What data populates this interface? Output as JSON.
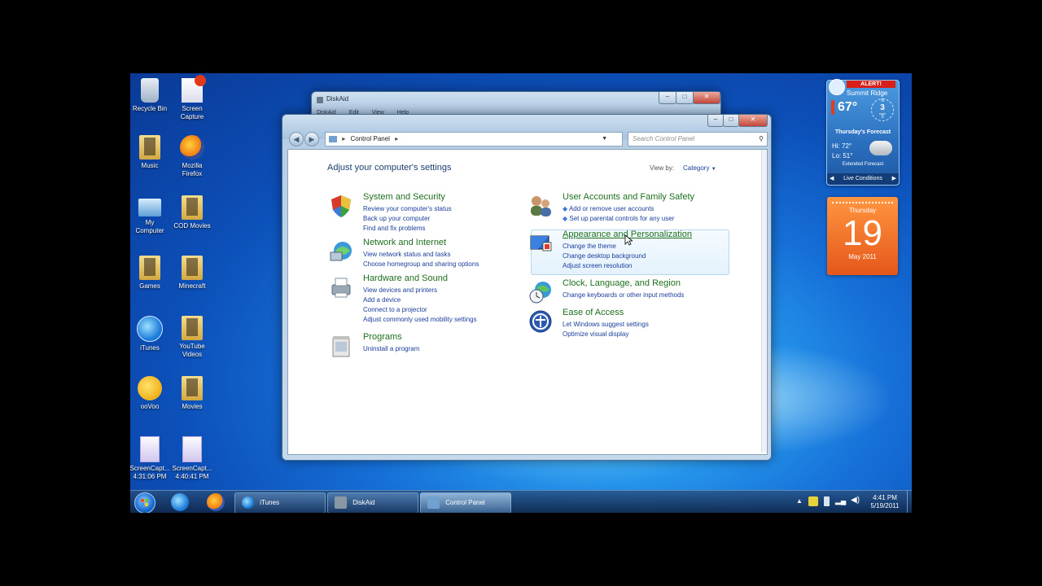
{
  "desktop": {
    "icons": [
      {
        "label": "Recycle Bin"
      },
      {
        "label": "Screen Capture"
      },
      {
        "label": "Music"
      },
      {
        "label": "Mozilla Firefox"
      },
      {
        "label": "My Computer"
      },
      {
        "label": "COD Movies"
      },
      {
        "label": "Games"
      },
      {
        "label": "Minecraft"
      },
      {
        "label": "iTunes"
      },
      {
        "label": "YouTube Videos"
      },
      {
        "label": "ooVoo"
      },
      {
        "label": "Movies"
      },
      {
        "label": "ScreenCapt... 4:31:06 PM"
      },
      {
        "label": "ScreenCapt... 4:40:41 PM"
      }
    ]
  },
  "diskaid_window": {
    "title": "DiskAid",
    "menu": [
      "DiskAid",
      "Edit",
      "View",
      "Help"
    ]
  },
  "control_panel": {
    "address": "Control Panel",
    "search_placeholder": "Search Control Panel",
    "heading": "Adjust your computer's settings",
    "view_by_label": "View by:",
    "view_by_value": "Category",
    "categories": [
      {
        "title": "System and Security",
        "links": [
          "Review your computer's status",
          "Back up your computer",
          "Find and fix problems"
        ]
      },
      {
        "title": "Network and Internet",
        "links": [
          "View network status and tasks",
          "Choose homegroup and sharing options"
        ]
      },
      {
        "title": "Hardware and Sound",
        "links": [
          "View devices and printers",
          "Add a device",
          "Connect to a projector",
          "Adjust commonly used mobility settings"
        ]
      },
      {
        "title": "Programs",
        "links": [
          "Uninstall a program"
        ]
      },
      {
        "title": "User Accounts and Family Safety",
        "links": [
          "Add or remove user accounts",
          "Set up parental controls for any user"
        ]
      },
      {
        "title": "Appearance and Personalization",
        "links": [
          "Change the theme",
          "Change desktop background",
          "Adjust screen resolution"
        ]
      },
      {
        "title": "Clock, Language, and Region",
        "links": [
          "Change keyboards or other input methods"
        ]
      },
      {
        "title": "Ease of Access",
        "links": [
          "Let Windows suggest settings",
          "Optimize visual display"
        ]
      }
    ]
  },
  "weather": {
    "alert": "ALERT!",
    "location": "Summit Ridge",
    "temp": "67°",
    "wind_speed": "3",
    "wind_unit": "mph",
    "wind_n": "N",
    "wind_s": "S",
    "forecast_title": "Thursday's Forecast",
    "hi": "Hi: 72°",
    "lo": "Lo: 51°",
    "extended": "Extended Forecast",
    "live": "Live Conditions"
  },
  "calendar": {
    "weekday": "Thursday",
    "day": "19",
    "month_year": "May 2011"
  },
  "taskbar": {
    "buttons": [
      {
        "label": "iTunes"
      },
      {
        "label": "DiskAid"
      },
      {
        "label": "Control Panel"
      }
    ],
    "time": "4:41 PM",
    "date": "5/19/2011"
  },
  "colors": {
    "link": "#1a3e9a",
    "category_title": "#1e6f1e",
    "calendar": "#f0701f"
  }
}
